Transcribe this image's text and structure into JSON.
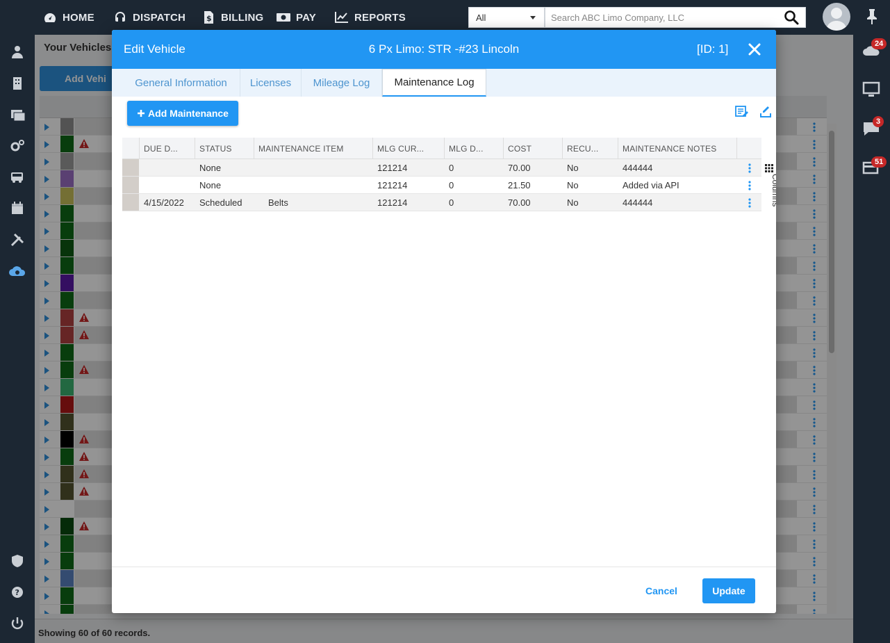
{
  "nav": {
    "items": [
      {
        "label": "HOME",
        "icon": "dashboard-icon"
      },
      {
        "label": "DISPATCH",
        "icon": "headset-icon"
      },
      {
        "label": "BILLING",
        "icon": "invoice-icon"
      },
      {
        "label": "PAY",
        "icon": "cash-icon"
      },
      {
        "label": "REPORTS",
        "icon": "chart-icon"
      }
    ],
    "search_scope": "All",
    "search_placeholder": "Search ABC Limo Company, LLC"
  },
  "right_badges": {
    "cloud": "24",
    "messages": "3",
    "cards": "51"
  },
  "background": {
    "page_title": "Your Vehicles",
    "add_button": "Add Vehi",
    "footer": "Showing 60 of 60 records.",
    "row_colors": [
      "#8f8f8f",
      "#0f6a18",
      "#9b9b9b",
      "#9b6fc4",
      "#c8c05a",
      "#0f6a18",
      "#0f6a18",
      "#0f5a14",
      "#0f6a18",
      "#5a1aa8",
      "#0f6a18",
      "#b04040",
      "#b04040",
      "#0f6a18",
      "#0f6a18",
      "#3cb371",
      "#b01818",
      "#545430",
      "#000000",
      "#0f6a18",
      "#545430",
      "#545430",
      "#ffffff",
      "#0a4a10",
      "#0f6a18",
      "#0f6a18",
      "#5b82c2",
      "#0f6a18",
      "#0f6a18"
    ],
    "row_warnings": [
      false,
      true,
      false,
      false,
      false,
      false,
      false,
      false,
      false,
      false,
      false,
      true,
      true,
      false,
      true,
      false,
      false,
      false,
      true,
      true,
      true,
      true,
      false,
      true,
      false,
      false,
      false,
      false,
      false
    ]
  },
  "modal": {
    "title": "Edit Vehicle",
    "vehicle": "6 Px Limo: STR -#23 Lincoln",
    "id_label": "[ID: 1]",
    "tabs": [
      {
        "label": "General Information",
        "active": false
      },
      {
        "label": "Licenses",
        "active": false
      },
      {
        "label": "Mileage Log",
        "active": false
      },
      {
        "label": "Maintenance Log",
        "active": true
      }
    ],
    "add_button": "Add Maintenance",
    "columns_label": "Columns",
    "grid": {
      "headers": [
        "DUE D...",
        "STATUS",
        "MAINTENANCE ITEM",
        "MLG CUR...",
        "MLG D...",
        "COST",
        "RECU...",
        "MAINTENANCE NOTES"
      ],
      "rows": [
        [
          "",
          "None",
          "",
          "121214",
          "0",
          "70.00",
          "No",
          "444444"
        ],
        [
          "",
          "None",
          "",
          "121214",
          "0",
          "21.50",
          "No",
          "Added via API"
        ],
        [
          "4/15/2022",
          "Scheduled",
          "Belts",
          "121214",
          "0",
          "70.00",
          "No",
          "444444"
        ]
      ]
    },
    "cancel": "Cancel",
    "update": "Update"
  }
}
